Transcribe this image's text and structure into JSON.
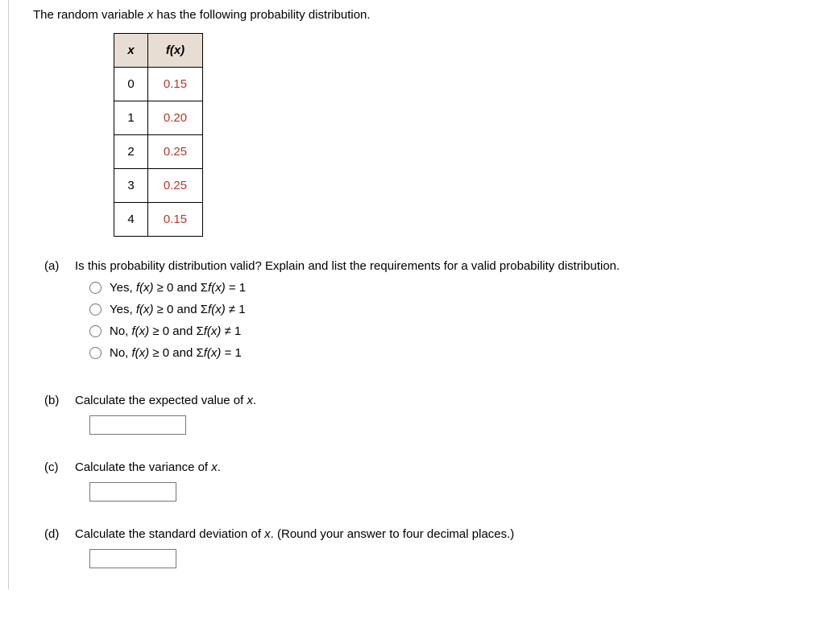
{
  "intro_pre": "The random variable ",
  "intro_var": "x",
  "intro_post": " has the following probability distribution.",
  "table": {
    "head_x": "x",
    "head_fx": "f(x)",
    "rows": [
      {
        "x": "0",
        "fx": "0.15"
      },
      {
        "x": "1",
        "fx": "0.20"
      },
      {
        "x": "2",
        "fx": "0.25"
      },
      {
        "x": "3",
        "fx": "0.25"
      },
      {
        "x": "4",
        "fx": "0.15"
      }
    ]
  },
  "parts": {
    "a": {
      "label": "(a)",
      "text": "Is this probability distribution valid? Explain and list the requirements for a valid probability distribution.",
      "choices": [
        {
          "pre": "Yes, ",
          "fx": "f(x)",
          "mid": " ≥ 0 and Σ",
          "fx2": "f(x)",
          "post": " = 1"
        },
        {
          "pre": "Yes, ",
          "fx": "f(x)",
          "mid": " ≥ 0 and Σ",
          "fx2": "f(x)",
          "post": " ≠ 1"
        },
        {
          "pre": "No, ",
          "fx": "f(x)",
          "mid": " ≥ 0 and Σ",
          "fx2": "f(x)",
          "post": " ≠ 1"
        },
        {
          "pre": "No, ",
          "fx": "f(x)",
          "mid": " ≥ 0 and Σ",
          "fx2": "f(x)",
          "post": " = 1"
        }
      ]
    },
    "b": {
      "label": "(b)",
      "text_pre": "Calculate the expected value of ",
      "text_var": "x",
      "text_post": "."
    },
    "c": {
      "label": "(c)",
      "text_pre": "Calculate the variance of ",
      "text_var": "x",
      "text_post": "."
    },
    "d": {
      "label": "(d)",
      "text_pre": "Calculate the standard deviation of ",
      "text_var": "x",
      "text_post": ". (Round your answer to four decimal places.)"
    }
  }
}
